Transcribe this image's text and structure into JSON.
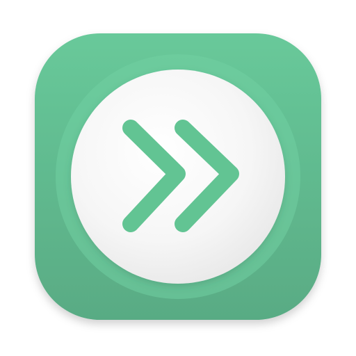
{
  "icon": {
    "name": "fast-forward-app-icon",
    "glyph": "double-chevron-right-icon"
  },
  "colors": {
    "tile_top": "#68c99a",
    "tile_bottom": "#59ab84",
    "ring": "#71cfa2",
    "disc_light": "#ffffff",
    "disc_shade": "#e6e6e6",
    "chevron": "#62c493"
  }
}
